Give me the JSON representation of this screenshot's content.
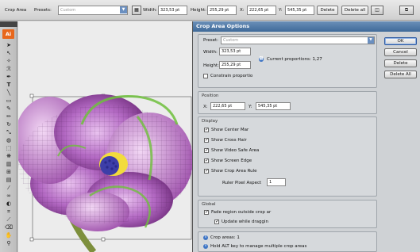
{
  "control_bar": {
    "crop_area_label": "Crop Area",
    "presets_label": "Presets:",
    "presets_value": "Custom",
    "width_label": "Width:",
    "width_value": "323,53 pt",
    "height_label": "Height:",
    "height_value": "255,29 pt",
    "x_label": "X:",
    "x_value": "222,65 pt",
    "y_label": "Y:",
    "y_value": "545,35 pt",
    "delete_label": "Delete",
    "delete_all_label": "Delete all"
  },
  "tools_panel": {
    "logo_text": "Ai",
    "tools": [
      "selection-tool",
      "direct-selection-tool",
      "magic-wand-tool",
      "lasso-tool",
      "pen-tool",
      "type-tool",
      "line-tool",
      "rectangle-tool",
      "paintbrush-tool",
      "pencil-tool",
      "rotate-tool",
      "scale-tool",
      "warp-tool",
      "free-transform-tool",
      "symbol-sprayer-tool",
      "column-graph-tool",
      "mesh-tool",
      "gradient-tool",
      "eyedropper-tool",
      "blend-tool",
      "live-paint-tool",
      "crop-area-tool",
      "slice-tool",
      "eraser-tool",
      "hand-tool",
      "zoom-tool"
    ]
  },
  "dialog": {
    "title": "Crop Area Options",
    "preset_label": "Preset:",
    "preset_value": "Custom",
    "width_label": "Width:",
    "width_value": "323,53 pt",
    "height_label": "Height:",
    "height_value": "255,29 pt",
    "current_proportions": "Current proportions: 1,27",
    "constrain_label": "Constrain proportio",
    "position": {
      "title": "Position",
      "x_label": "X:",
      "x_value": "222,65 pt",
      "y_label": "Y:",
      "y_value": "545,35 pt"
    },
    "display": {
      "title": "Display",
      "show_center_mark": "Show Center Mar",
      "show_cross_hairs": "Show Cross Hair",
      "show_video_safe": "Show Video Safe Area",
      "show_screen_edge": "Show Screen Edge",
      "show_crop_area_rulers": "Show Crop Area Rule",
      "ruler_pixel_aspect_label": "Ruler Pixel Aspect",
      "ruler_pixel_aspect_value": "1"
    },
    "global": {
      "title": "Global",
      "fade_region": "Fade region outside crop ar",
      "update_while_dragging": "Update while draggin"
    },
    "info": {
      "crop_areas": "Crop areas: 1",
      "hint": "Hold ALT key to manage multiple crop areas"
    },
    "buttons": {
      "ok": "OK",
      "cancel": "Cancel",
      "delete": "Delete",
      "delete_all": "Delete All"
    }
  },
  "colors": {
    "title_bar": "#4a74a6",
    "flower_petal": "#b46ac4",
    "flower_center": "#f2dc3c",
    "mesh_green": "#6fbf3c",
    "ai_logo": "#e8671c"
  }
}
